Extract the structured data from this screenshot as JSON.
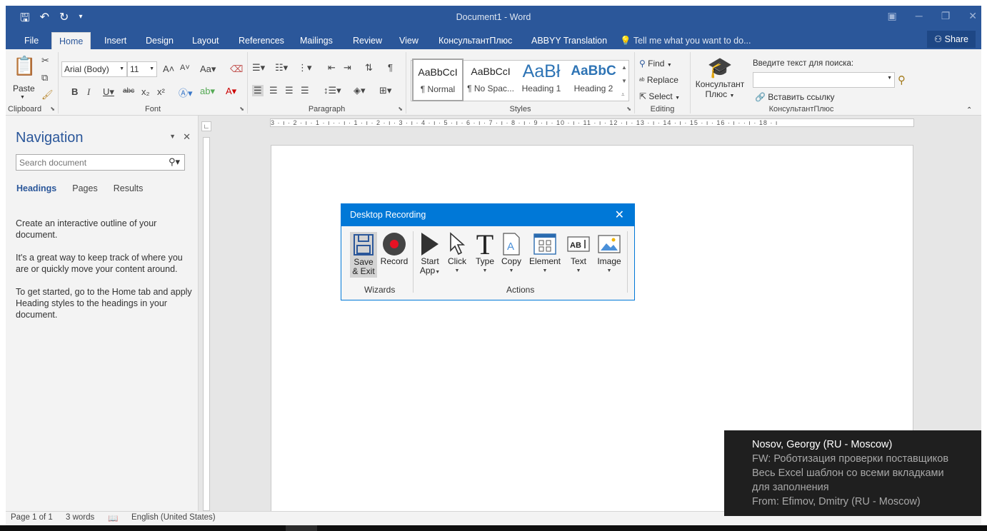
{
  "window": {
    "title": "Document1 - Word"
  },
  "tabs": [
    "File",
    "Home",
    "Insert",
    "Design",
    "Layout",
    "References",
    "Mailings",
    "Review",
    "View",
    "КонсультантПлюс",
    "ABBYY Translation"
  ],
  "tell_me": "Tell me what you want to do...",
  "share_label": "Share",
  "ribbon": {
    "clipboard": {
      "paste_label": "Paste",
      "group_label": "Clipboard"
    },
    "font": {
      "font_name": "Arial (Body)",
      "font_size": "11",
      "group_label": "Font"
    },
    "paragraph": {
      "group_label": "Paragraph"
    },
    "styles": {
      "group_label": "Styles",
      "items": [
        {
          "sample": "AaBbCcI",
          "name": "¶ Normal"
        },
        {
          "sample": "AaBbCcI",
          "name": "¶ No Spac..."
        },
        {
          "sample": "AaBł",
          "name": "Heading 1"
        },
        {
          "sample": "AaBbC",
          "name": "Heading 2"
        }
      ]
    },
    "editing": {
      "find": "Find",
      "replace": "Replace",
      "select": "Select",
      "group_label": "Editing"
    },
    "konsultant": {
      "button_line1": "Консультант",
      "button_line2": "Плюс",
      "search_label": "Введите текст для поиска:",
      "insert_link": "Вставить ссылку",
      "group_label": "КонсультантПлюс"
    }
  },
  "navigation": {
    "title": "Navigation",
    "search_placeholder": "Search document",
    "tabs": [
      "Headings",
      "Pages",
      "Results"
    ],
    "paragraphs": [
      "Create an interactive outline of your document.",
      "It's a great way to keep track of where you are or quickly move your content around.",
      "To get started, go to the Home tab and apply Heading styles to the headings in your document."
    ]
  },
  "ruler": {
    "text": "3 · ı · 2 · ı · 1 · ı ·  · ı · 1 · ı · 2 · ı · 3 · ı · 4 · ı · 5 · ı · 6 · ı · 7 · ı · 8 · ı · 9 · ı · 10 · ı · 11 · ı · 12 · ı · 13 · ı · 14 · ı · 15 · ı · 16 · ı ·  · ı · 18 · ı"
  },
  "statusbar": {
    "page": "Page 1 of 1",
    "words": "3 words",
    "language": "English (United States)"
  },
  "dialog": {
    "title": "Desktop Recording",
    "buttons": [
      {
        "line1": "Save",
        "line2": "& Exit"
      },
      {
        "line1": "Record",
        "line2": ""
      },
      {
        "line1": "Start",
        "line2": "App"
      },
      {
        "line1": "Click",
        "line2": ""
      },
      {
        "line1": "Type",
        "line2": ""
      },
      {
        "line1": "Copy",
        "line2": ""
      },
      {
        "line1": "Element",
        "line2": ""
      },
      {
        "line1": "Text",
        "line2": ""
      },
      {
        "line1": "Image",
        "line2": ""
      }
    ],
    "groups": [
      "Wizards",
      "Actions"
    ]
  },
  "notification": {
    "sender": "Nosov, Georgy (RU - Moscow)",
    "lines": [
      "FW: Роботизация проверки поставщиков",
      "Весь Excel шаблон со всеми вкладками",
      "для заполнения",
      "From: Efimov, Dmitry (RU - Moscow)"
    ]
  },
  "colors": {
    "word_blue": "#2b579a",
    "dialog_blue": "#0078d7",
    "record_red": "#e81123",
    "toast_bg": "#1f1f1f"
  }
}
